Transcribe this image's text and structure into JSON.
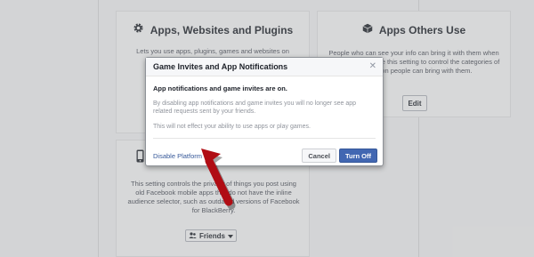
{
  "background": {
    "apps_panel": {
      "title": "Apps, Websites and Plugins",
      "description": "Lets you use apps, plugins, games and websites on"
    },
    "others_panel": {
      "title": "Apps Others Use",
      "description": "People who can see your info can bring it with them when they use apps. Use this setting to control the categories of information people can bring with them.",
      "edit_label": "Edit"
    },
    "mobile_panel": {
      "description": "This setting controls the privacy of things you post using old Facebook mobile apps that do not have the inline audience selector, such as outdated versions of Facebook for BlackBerry.",
      "audience_label": "Friends"
    }
  },
  "dialog": {
    "title": "Game Invites and App Notifications",
    "close_glyph": "✕",
    "heading": "App notifications and game invites are on.",
    "paragraph1": "By disabling app notifications and game invites you will no longer see app related requests sent by your friends.",
    "paragraph2": "This will not effect your ability to use apps or play games.",
    "disable_link": "Disable Platform",
    "cancel_label": "Cancel",
    "turnoff_label": "Turn Off"
  },
  "colors": {
    "accent": "#4267b2",
    "link": "#365899",
    "arrow": "#b00d14"
  },
  "icons": {
    "apps_panel": "gear-icon",
    "others_panel": "cube-icon",
    "mobile_panel": "mobile-phone-icon",
    "friends": "friends-icon",
    "close": "close-icon",
    "annotation": "red-arrow"
  }
}
